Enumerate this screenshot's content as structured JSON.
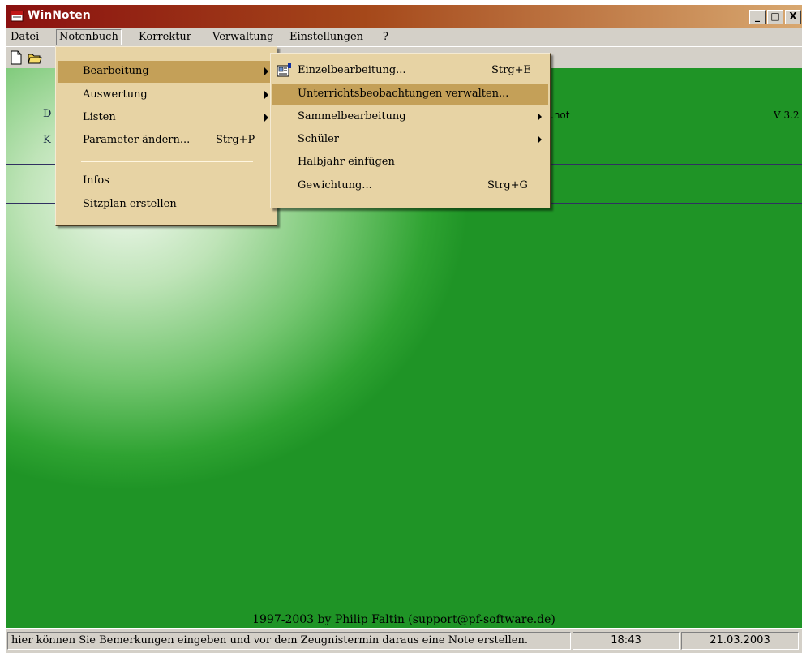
{
  "window": {
    "title": "WinNoten"
  },
  "title_buttons": {
    "minimize": "_",
    "maximize": "□",
    "close": "X"
  },
  "menubar": [
    {
      "id": "datei",
      "label": "Datei"
    },
    {
      "id": "notenbuch",
      "label": "Notenbuch"
    },
    {
      "id": "korrektur",
      "label": "Korrektur"
    },
    {
      "id": "verwaltung",
      "label": "Verwaltung"
    },
    {
      "id": "einstellungen",
      "label": "Einstellungen"
    },
    {
      "id": "help",
      "label": "?"
    }
  ],
  "main": {
    "link_d": "D",
    "link_k": "K",
    "file_suffix": ".not",
    "version": "V 3.2",
    "copyright": "1997-2003 by Philip Faltin (support@pf-software.de)"
  },
  "notenbuch_menu": [
    {
      "label": "Bearbeitung",
      "shortcut": "",
      "submenu": true,
      "highlighted": true
    },
    {
      "label": "Auswertung",
      "shortcut": "",
      "submenu": true
    },
    {
      "label": "Listen",
      "shortcut": "",
      "submenu": true
    },
    {
      "label": "Parameter ändern...",
      "shortcut": "Strg+P",
      "submenu": false
    },
    {
      "label": "Infos",
      "shortcut": "",
      "submenu": false
    },
    {
      "label": "Sitzplan erstellen",
      "shortcut": "",
      "submenu": false
    }
  ],
  "bearbeitung_menu": [
    {
      "label": "Einzelbearbeitung...",
      "shortcut": "Strg+E",
      "submenu": false,
      "icon": "student-card-icon"
    },
    {
      "label": "Unterrichtsbeobachtungen verwalten...",
      "shortcut": "",
      "submenu": false,
      "highlighted": true
    },
    {
      "label": "Sammelbearbeitung",
      "shortcut": "",
      "submenu": true
    },
    {
      "label": "Schüler",
      "shortcut": "",
      "submenu": true
    },
    {
      "label": "Halbjahr einfügen",
      "shortcut": "",
      "submenu": false
    },
    {
      "label": "Gewichtung...",
      "shortcut": "Strg+G",
      "submenu": false
    }
  ],
  "statusbar": {
    "message": "hier können Sie Bemerkungen eingeben und vor dem Zeugnistermin daraus eine Note erstellen.",
    "time": "18:43",
    "date": "21.03.2003"
  },
  "colors": {
    "menu_bg": "#e7d3a4",
    "menu_highlight": "#c4a058",
    "title_start": "#8a1010",
    "title_end": "#d8a870"
  }
}
